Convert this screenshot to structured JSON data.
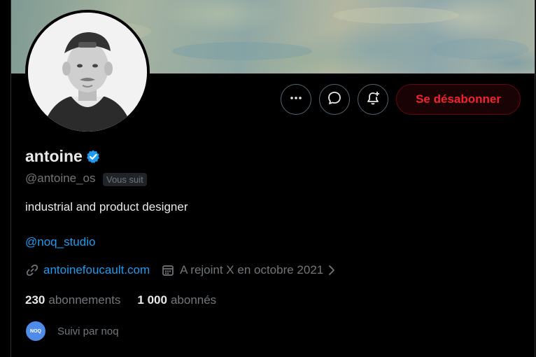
{
  "profile": {
    "display_name": "antoine",
    "handle": "@antoine_os",
    "follows_you_badge": "Vous suit",
    "bio": "industrial and product designer",
    "mention": "@noq_studio",
    "website": "antoinefoucault.com",
    "joined": "A rejoint X en octobre 2021",
    "verified": true
  },
  "actions": {
    "more_icon": "more-icon",
    "message_icon": "message-icon",
    "notifications_icon": "bell-plus-icon",
    "unfollow_label": "Se désabonner"
  },
  "stats": {
    "following_count": "230",
    "following_label": "abonnements",
    "followers_count": "1 000",
    "followers_label": "abonnés"
  },
  "followed_by": {
    "avatar_text": "NOQ",
    "text": "Suivi par noq"
  },
  "colors": {
    "background": "#000000",
    "accent_blue": "#1d9bf0",
    "unfollow_red": "#f4212e",
    "muted_text": "#71767b",
    "primary_text": "#e7e9ea"
  }
}
